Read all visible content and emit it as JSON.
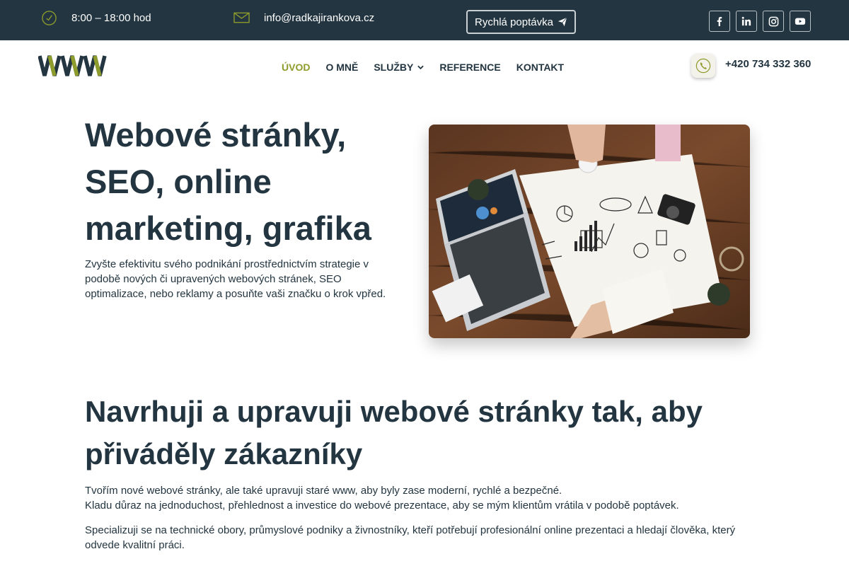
{
  "topbar": {
    "hours": "8:00 – 18:00 hod",
    "email": "info@radkajirankova.cz",
    "quick_request": "Rychlá poptávka",
    "icons": [
      "clock-icon",
      "mail-icon",
      "send-icon",
      "facebook-icon",
      "linkedin-icon",
      "instagram-icon",
      "youtube-icon"
    ]
  },
  "header": {
    "logo_text": "WWW",
    "nav": [
      "ÚVOD",
      "O MNĚ",
      "SLUŽBY",
      "REFERENCE",
      "KONTAKT"
    ],
    "phone": "+420 734 332 360"
  },
  "hero": {
    "title": "Webové stránky, SEO, online marketing, grafika",
    "subtitle": "Zvyšte efektivitu svého podnikání prostřednictvím strategie v podobě nových či upravených webových stránek, SEO optimalizace, nebo reklamy a posuňte vaši značku o krok vpřed."
  },
  "section": {
    "title": "Navrhuji a upravuji webové stránky tak, aby přiváděly zákazníky",
    "p1_line1": "Tvořím nové webové stránky, ale také upravuji staré www, aby byly zase moderní, rychlé a bezpečné.",
    "p1_line2": "Kladu důraz na jednoduchost, přehlednost a investice do webové prezentace, aby se mým klientům vrátila v podobě poptávek.",
    "p2": "Specializuji se na technické obory, průmyslové podniky a živnostníky, kteří potřebují profesionální online prezentaci a hledají člověka, který odvede kvalitní práci."
  },
  "colors": {
    "dark": "#233540",
    "accent": "#8e9c2c"
  }
}
